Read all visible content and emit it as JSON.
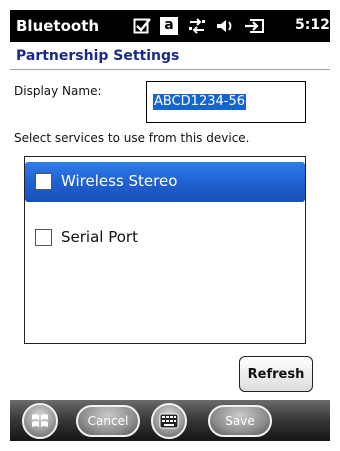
{
  "status_bar": {
    "app_title": "Bluetooth",
    "clock": "5:12",
    "icons": [
      "checkbox-icon",
      "a-mode-icon",
      "connectivity-icon",
      "volume-icon",
      "battery-icon"
    ],
    "a_mode_label": "a"
  },
  "header": {
    "title": "Partnership Settings"
  },
  "form": {
    "display_name_label": "Display Name:",
    "display_name_value": "ABCD1234-56",
    "services_label": "Select services to use from this device."
  },
  "services": [
    {
      "label": "Wireless Stereo",
      "checked": false,
      "selected": true
    },
    {
      "label": "Serial Port",
      "checked": false,
      "selected": false
    }
  ],
  "refresh_label": "Refresh",
  "bottom_bar": {
    "cancel_label": "Cancel",
    "save_label": "Save"
  },
  "colors": {
    "title_blue": "#1a2a8c",
    "selection_blue": "#1f5fcf",
    "text_highlight": "#1565d1"
  }
}
